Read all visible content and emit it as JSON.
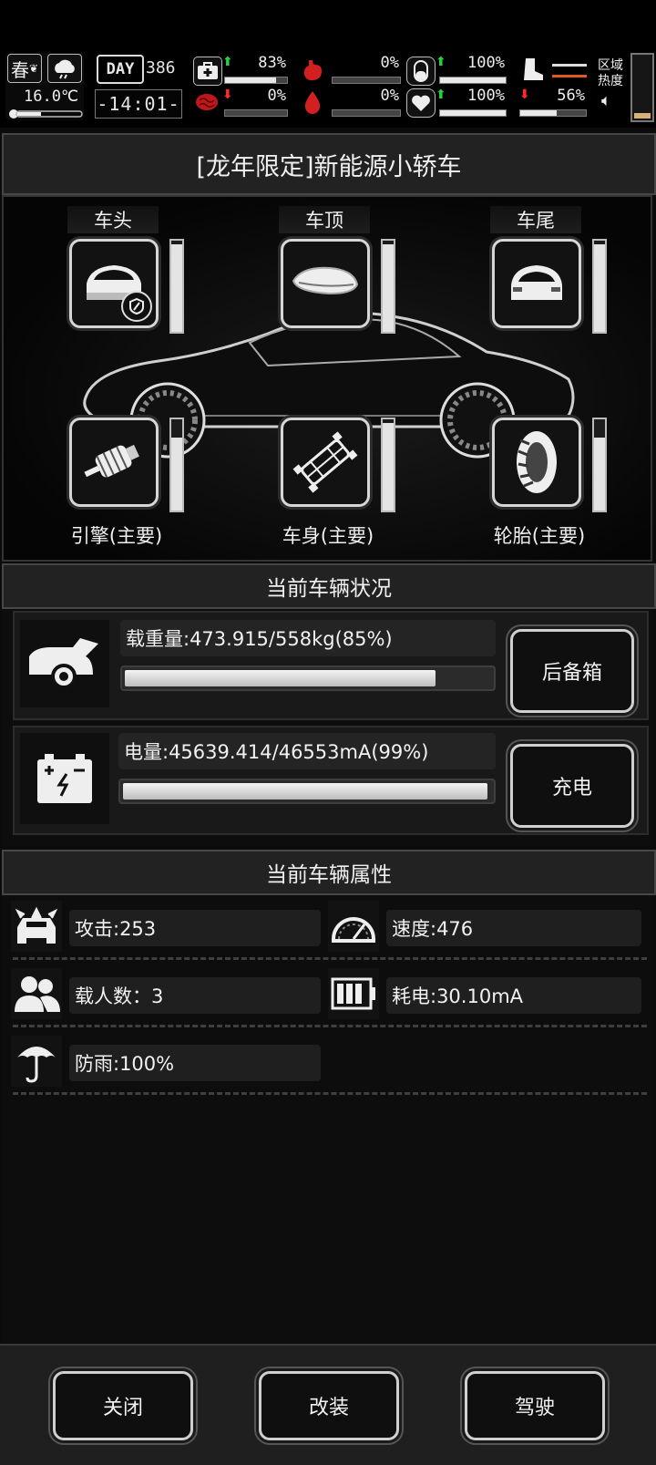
{
  "top_bar": {
    "season": "春",
    "temperature": "16.0℃",
    "day_label": "DAY",
    "day": "386",
    "time": "-14:01-",
    "stats": [
      {
        "id": "health",
        "value": "83%",
        "trend": "up",
        "fill": 0.83
      },
      {
        "id": "hunger",
        "value": "0%",
        "trend": "none",
        "fill": 0.0
      },
      {
        "id": "stamina",
        "value": "100%",
        "trend": "up",
        "fill": 1.0
      },
      {
        "id": "sanity",
        "value": "0%",
        "trend": "down",
        "fill": 0.0
      },
      {
        "id": "thirst",
        "value": "0%",
        "trend": "none",
        "fill": 0.0
      },
      {
        "id": "heart",
        "value": "100%",
        "trend": "up",
        "fill": 1.0
      },
      {
        "id": "boots",
        "value": "56%",
        "trend": "down",
        "fill": 0.56
      }
    ],
    "zone_heat_label": "区域\n热度",
    "zone_heat_line1": "区域",
    "zone_heat_line2": "热度",
    "zone_heat_level": 0.08,
    "colors": {
      "up": "#2ecc40",
      "down": "#ff2b2b",
      "heat": "#d9b07a",
      "boots_line": "#e05a1c"
    }
  },
  "vehicle": {
    "title": "[龙年限定]新能源小轿车",
    "slots": [
      {
        "key": "front",
        "label": "车头",
        "icon": "car-front-icon",
        "durability": 0.96,
        "has_shield": true
      },
      {
        "key": "roof",
        "label": "车顶",
        "icon": "roof-box-icon",
        "durability": 0.96
      },
      {
        "key": "rear",
        "label": "车尾",
        "icon": "car-rear-icon",
        "durability": 0.96
      },
      {
        "key": "engine",
        "label": "引擎(主要)",
        "icon": "engine-icon",
        "durability": 0.8
      },
      {
        "key": "body",
        "label": "车身(主要)",
        "icon": "chassis-icon",
        "durability": 0.96
      },
      {
        "key": "tire",
        "label": "轮胎(主要)",
        "icon": "tire-icon",
        "durability": 0.8
      }
    ]
  },
  "status": {
    "section_title": "当前车辆状况",
    "load": {
      "text": "载重量:473.915/558kg(85%)",
      "fill": 0.85,
      "button": "后备箱",
      "icon": "car-trunk-icon"
    },
    "power": {
      "text": "电量:45639.414/46553mA(99%)",
      "fill": 0.99,
      "button": "充电",
      "icon": "battery-icon"
    }
  },
  "attributes": {
    "section_title": "当前车辆属性",
    "items": [
      {
        "key": "attack",
        "text": "攻击:253",
        "icon": "spiked-car-icon"
      },
      {
        "key": "speed",
        "text": "速度:476",
        "icon": "speedometer-icon"
      },
      {
        "key": "passengers",
        "text": "载人数：3",
        "icon": "people-icon"
      },
      {
        "key": "consumption",
        "text": "耗电:30.10mA",
        "icon": "battery-level-icon"
      },
      {
        "key": "rainproof",
        "text": "防雨:100%",
        "icon": "umbrella-icon"
      }
    ]
  },
  "footer": {
    "close": "关闭",
    "modify": "改装",
    "drive": "驾驶"
  }
}
